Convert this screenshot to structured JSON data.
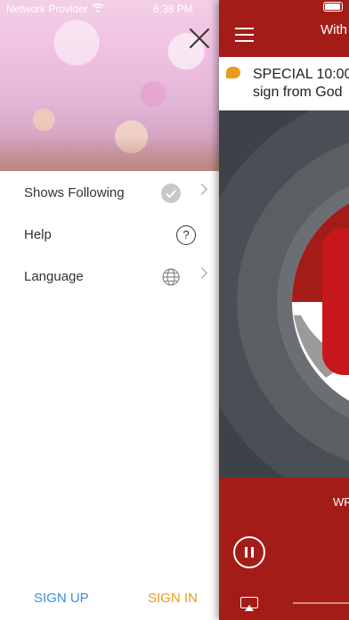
{
  "status_bar": {
    "carrier": "Network Provider",
    "time": "6:38 PM"
  },
  "drawer": {
    "menu_items": [
      {
        "label": "Shows Following",
        "icon": "check-circle-icon",
        "has_chevron": true
      },
      {
        "label": "Help",
        "icon": "question-circle-icon",
        "has_chevron": false
      },
      {
        "label": "Language",
        "icon": "globe-icon",
        "has_chevron": true
      }
    ],
    "help_glyph": "?",
    "sign_up_label": "SIGN UP",
    "sign_in_label": "SIGN IN"
  },
  "main": {
    "title": "With",
    "notice_text_line1": "SPECIAL 10:00",
    "notice_text_line2": "sign from God",
    "station_text": "WR"
  },
  "colors": {
    "brand_red": "#a41c18",
    "sign_up": "#3f8ce3",
    "sign_in": "#e99a1c"
  }
}
